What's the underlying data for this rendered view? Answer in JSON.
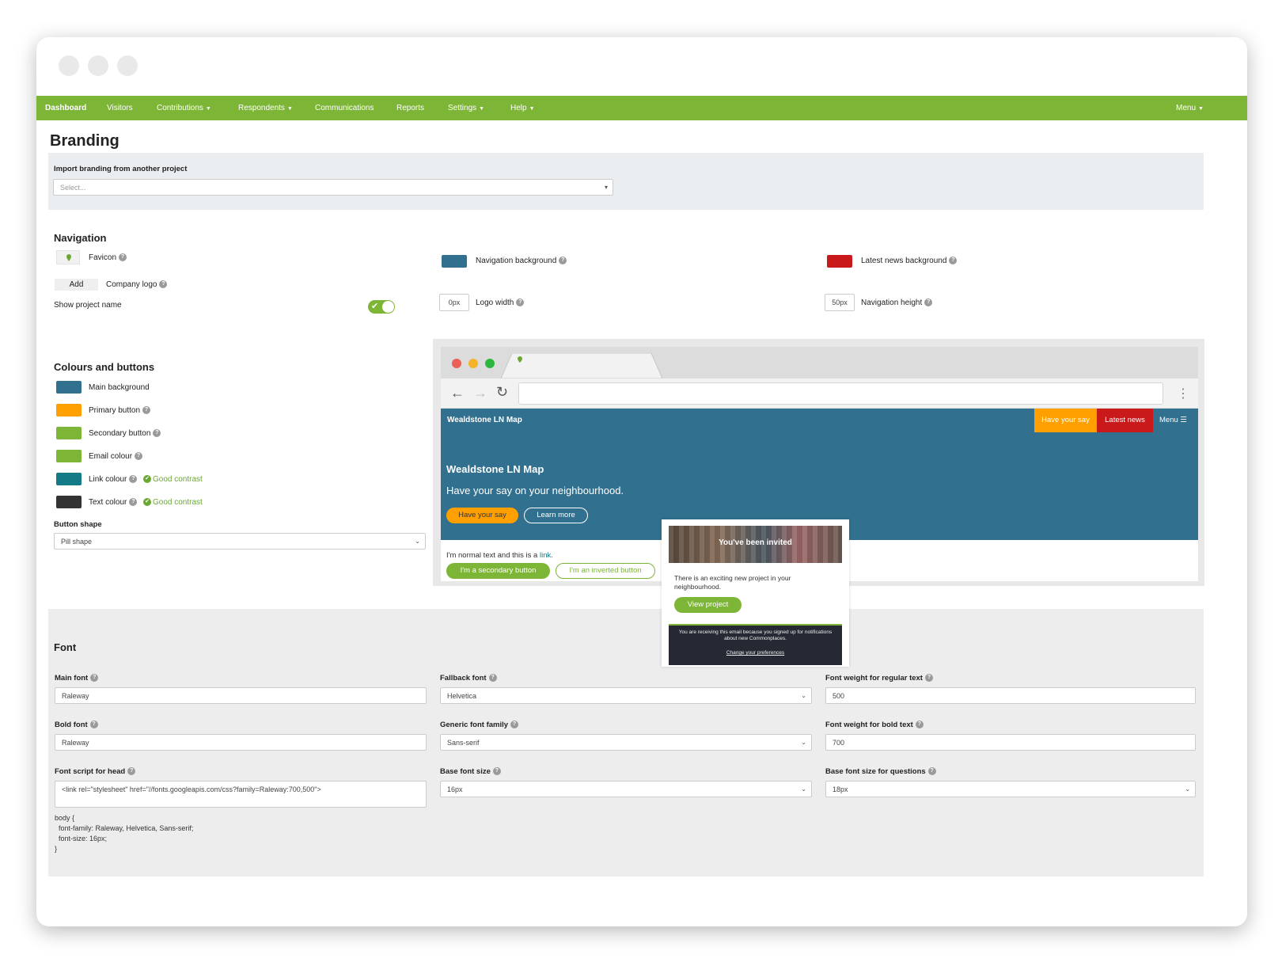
{
  "nav": {
    "items": [
      {
        "label": "Dashboard",
        "dropdown": false,
        "active": true
      },
      {
        "label": "Visitors",
        "dropdown": false
      },
      {
        "label": "Contributions",
        "dropdown": true
      },
      {
        "label": "Respondents",
        "dropdown": true
      },
      {
        "label": "Communications",
        "dropdown": false
      },
      {
        "label": "Reports",
        "dropdown": false
      },
      {
        "label": "Settings",
        "dropdown": true
      },
      {
        "label": "Help",
        "dropdown": true
      }
    ],
    "menu_label": "Menu",
    "bg_color": "#7db537"
  },
  "page_title": "Branding",
  "import": {
    "label": "Import branding from another project",
    "placeholder": "Select..."
  },
  "navigation": {
    "heading": "Navigation",
    "favicon_label": "Favicon",
    "add_button": "Add",
    "company_logo_label": "Company logo",
    "show_project_name_label": "Show project name",
    "show_project_name_on": true,
    "nav_background_label": "Navigation background",
    "nav_background_color": "#31708f",
    "logo_width_value": "0px",
    "logo_width_label": "Logo width",
    "latest_news_label": "Latest news background",
    "latest_news_color": "#c9191a",
    "nav_height_value": "50px",
    "nav_height_label": "Navigation height"
  },
  "colours": {
    "heading": "Colours and buttons",
    "items": [
      {
        "label": "Main background",
        "color": "#31708f",
        "help": false,
        "contrast": ""
      },
      {
        "label": "Primary button",
        "color": "#ffa000",
        "help": true,
        "contrast": ""
      },
      {
        "label": "Secondary button",
        "color": "#7db537",
        "help": true,
        "contrast": ""
      },
      {
        "label": "Email colour",
        "color": "#7db537",
        "help": true,
        "contrast": ""
      },
      {
        "label": "Link colour",
        "color": "#137b86",
        "help": true,
        "contrast": "Good contrast"
      },
      {
        "label": "Text colour",
        "color": "#333333",
        "help": true,
        "contrast": "Good contrast"
      }
    ],
    "button_shape_label": "Button shape",
    "button_shape_value": "Pill shape"
  },
  "preview": {
    "site_name": "Wealdstone LN Map",
    "have_your_say": "Have your say",
    "latest_news": "Latest news",
    "menu": "Menu",
    "hero_title": "Wealdstone LN Map",
    "hero_subtitle": "Have your say on your neighbourhood.",
    "hero_primary_btn": "Have your say",
    "hero_secondary_btn": "Learn more",
    "body_text": "I'm normal text and this is a ",
    "link_text": "link.",
    "secondary_btn": "I'm a secondary button",
    "inverted_btn": "I'm an inverted button"
  },
  "email": {
    "banner_text": "You've been invited",
    "body": "There is an exciting new project in your neighbourhood.",
    "button": "View project",
    "footer_text": "You are receiving this email because you signed up for notifications about new Commonplaces.",
    "footer_link": "Change your preferences"
  },
  "font": {
    "heading": "Font",
    "main_font_label": "Main font",
    "main_font_value": "Raleway",
    "fallback_font_label": "Fallback font",
    "fallback_font_value": "Helvetica",
    "weight_regular_label": "Font weight for regular text",
    "weight_regular_value": "500",
    "bold_font_label": "Bold font",
    "bold_font_value": "Raleway",
    "generic_family_label": "Generic font family",
    "generic_family_value": "Sans-serif",
    "weight_bold_label": "Font weight for bold text",
    "weight_bold_value": "700",
    "script_label": "Font script for head",
    "script_value": "<link rel=\"stylesheet\" href=\"//fonts.googleapis.com/css?family=Raleway:700,500\">",
    "base_size_label": "Base font size",
    "base_size_value": "16px",
    "question_size_label": "Base font size for questions",
    "question_size_value": "18px",
    "css_line1": "body {",
    "css_line2": "  font-family: Raleway, Helvetica, Sans-serif;",
    "css_line3": "  font-size: 16px;",
    "css_line4": "}"
  }
}
